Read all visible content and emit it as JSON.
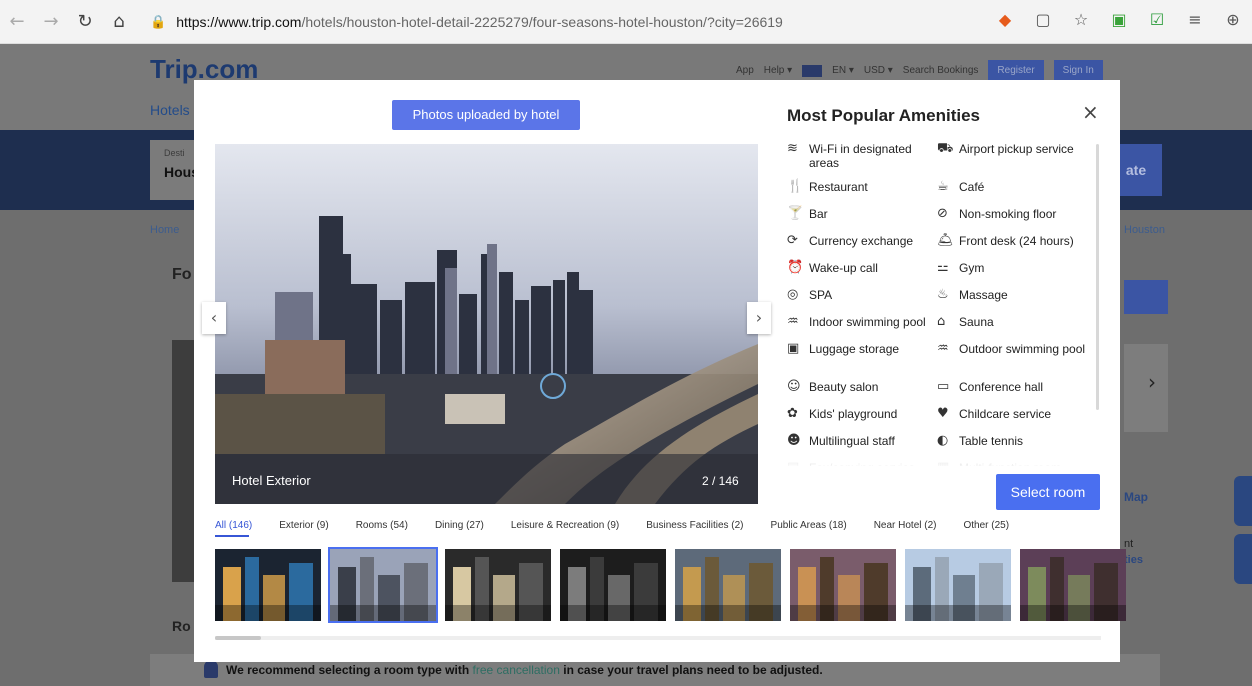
{
  "browser": {
    "url_host": "https://www.trip.com",
    "url_path": "/hotels/houston-hotel-detail-2225279/four-seasons-hotel-houston/?city=26619"
  },
  "page": {
    "logo_main": "Trip",
    "logo_suffix": ".com",
    "top_links": {
      "app": "App",
      "help": "Help ▾",
      "lang": "EN ▾",
      "currency": "USD ▾",
      "search_bookings": "Search Bookings",
      "register": "Register",
      "sign_in": "Sign In"
    },
    "hotels_tab": "Hotels",
    "search_label": "Desti",
    "search_value": "Hous",
    "update_label": "ate",
    "breadcrumb": "Home",
    "breadcrumb_right": "Houston",
    "hotel_name": "Fo",
    "map_link": "Map",
    "facility_lines": [
      "nt",
      "ties"
    ],
    "room_tab": "Ro",
    "recommend_prefix": "We recommend selecting a room type with ",
    "recommend_link": "free cancellation",
    "recommend_suffix": " in case your travel plans need to be adjusted."
  },
  "modal": {
    "photos_button": "Photos uploaded by hotel",
    "photo_caption": "Hotel Exterior",
    "photo_count": "2 / 146",
    "amenities_title": "Most Popular Amenities",
    "close": "×",
    "amenities": [
      [
        {
          "icon": "wifi-icon",
          "glyph": "≋",
          "label": "Wi-Fi in designated areas"
        },
        {
          "icon": "airport-shuttle-icon",
          "glyph": "⛟",
          "label": "Airport pickup service"
        }
      ],
      [
        {
          "icon": "restaurant-icon",
          "glyph": "🍴",
          "label": "Restaurant"
        },
        {
          "icon": "cafe-icon",
          "glyph": "☕",
          "label": "Café"
        }
      ],
      [
        {
          "icon": "bar-icon",
          "glyph": "🍸",
          "label": "Bar"
        },
        {
          "icon": "no-smoking-icon",
          "glyph": "⊘",
          "label": "Non-smoking floor"
        }
      ],
      [
        {
          "icon": "currency-exchange-icon",
          "glyph": "⟳",
          "label": "Currency exchange"
        },
        {
          "icon": "front-desk-icon",
          "glyph": "🛎",
          "label": "Front desk (24 hours)"
        }
      ],
      [
        {
          "icon": "wake-up-call-icon",
          "glyph": "⏰",
          "label": "Wake-up call"
        },
        {
          "icon": "gym-icon",
          "glyph": "⚍",
          "label": "Gym"
        }
      ],
      [
        {
          "icon": "spa-icon",
          "glyph": "◎",
          "label": "SPA"
        },
        {
          "icon": "massage-icon",
          "glyph": "♨",
          "label": "Massage"
        }
      ],
      [
        {
          "icon": "indoor-pool-icon",
          "glyph": "♒",
          "label": "Indoor swimming pool"
        },
        {
          "icon": "sauna-icon",
          "glyph": "⌂",
          "label": "Sauna"
        }
      ],
      [
        {
          "icon": "luggage-icon",
          "glyph": "▣",
          "label": "Luggage storage"
        },
        {
          "icon": "outdoor-pool-icon",
          "glyph": "♒",
          "label": "Outdoor swimming pool"
        }
      ],
      [
        {
          "icon": "beauty-salon-icon",
          "glyph": "☺",
          "label": "Beauty salon"
        },
        {
          "icon": "conference-hall-icon",
          "glyph": "▭",
          "label": "Conference hall"
        }
      ],
      [
        {
          "icon": "kids-playground-icon",
          "glyph": "✿",
          "label": "Kids' playground"
        },
        {
          "icon": "childcare-icon",
          "glyph": "♥",
          "label": "Childcare service"
        }
      ],
      [
        {
          "icon": "multilingual-staff-icon",
          "glyph": "☻",
          "label": "Multilingual staff"
        },
        {
          "icon": "table-tennis-icon",
          "glyph": "◐",
          "label": "Table tennis"
        }
      ],
      [
        {
          "icon": "fax-icon",
          "glyph": "▤",
          "label": "Fax/copying service"
        },
        {
          "icon": "multi-function-room-icon",
          "glyph": "▦",
          "label": "Multi-function room"
        }
      ]
    ],
    "select_room": "Select room",
    "categories": [
      "All (146)",
      "Exterior (9)",
      "Rooms (54)",
      "Dining (27)",
      "Leisure & Recreation (9)",
      "Business Facilities (2)",
      "Public Areas (18)",
      "Near Hotel (2)",
      "Other (25)"
    ],
    "selected_thumb_index": 1,
    "thumb_scroll_fraction": 0.05
  }
}
